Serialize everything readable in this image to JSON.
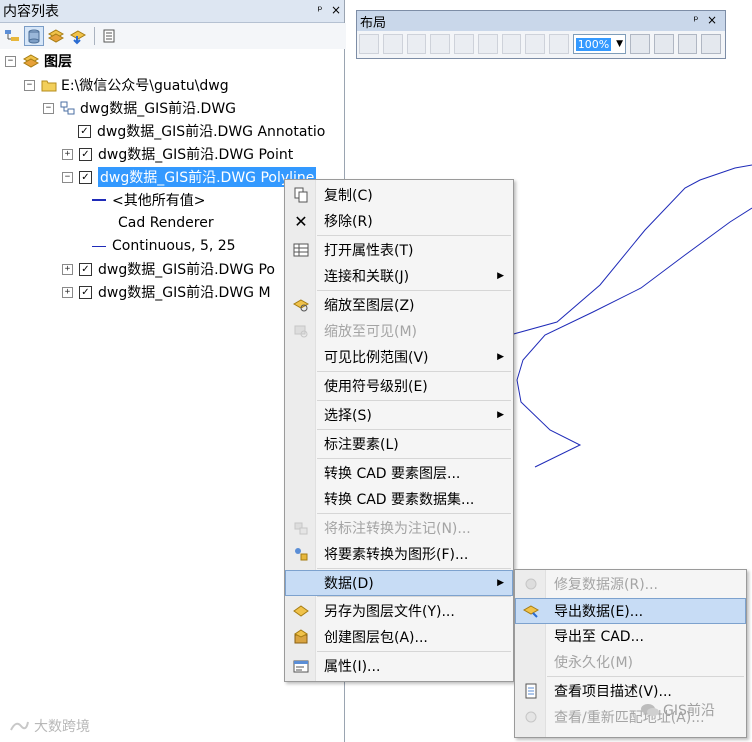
{
  "toc": {
    "title": "内容列表",
    "pin": "ᵖ",
    "close": "×",
    "tools": [
      "list-by-drawing-order-icon",
      "list-by-source-icon",
      "list-by-visibility-icon",
      "list-by-selection-icon",
      "options-icon"
    ],
    "tree": {
      "root": "图层",
      "folder": "E:\\微信公众号\\guatu\\dwg",
      "dataset": "dwg数据_GIS前沿.DWG",
      "layers": {
        "annotation": "dwg数据_GIS前沿.DWG Annotatio",
        "point": "dwg数据_GIS前沿.DWG Point",
        "polyline": "dwg数据_GIS前沿.DWG Polyline",
        "polygon": "dwg数据_GIS前沿.DWG Po",
        "multipatch": "dwg数据_GIS前沿.DWG M"
      },
      "legend_all_other": "<其他所有值>",
      "legend_renderer": "Cad Renderer",
      "legend_continuous": "Continuous, 5, 25"
    }
  },
  "layout": {
    "title": "布局",
    "pin": "ᵖ",
    "close": "×",
    "zoom": "100%"
  },
  "context_menu": {
    "copy": "复制(C)",
    "remove": "移除(R)",
    "open_table": "打开属性表(T)",
    "joins": "连接和关联(J)",
    "zoom_to_layer": "缩放至图层(Z)",
    "zoom_to_visible": "缩放至可见(M)",
    "scale_range": "可见比例范围(V)",
    "symbol_levels": "使用符号级别(E)",
    "selection": "选择(S)",
    "label_features": "标注要素(L)",
    "convert_cad_layer": "转换 CAD 要素图层...",
    "convert_cad_dataset": "转换 CAD 要素数据集...",
    "convert_labels": "将标注转换为注记(N)...",
    "convert_graphics": "将要素转换为图形(F)...",
    "data": "数据(D)",
    "save_layer_file": "另存为图层文件(Y)...",
    "create_layer_package": "创建图层包(A)...",
    "properties": "属性(I)..."
  },
  "submenu": {
    "repair_source": "修复数据源(R)...",
    "export_data": "导出数据(E)...",
    "export_cad": "导出至 CAD...",
    "make_permanent": "使永久化(M)",
    "view_item_description": "查看项目描述(V)...",
    "review_rematch": "查看/重新匹配地址(A)..."
  },
  "watermarks": {
    "left": "大数跨境",
    "right": "GIS前沿"
  },
  "colors": {
    "selection": "#3399ff",
    "menu_highlight": "#c7dcf5",
    "polyline": "#1f2bb8"
  }
}
